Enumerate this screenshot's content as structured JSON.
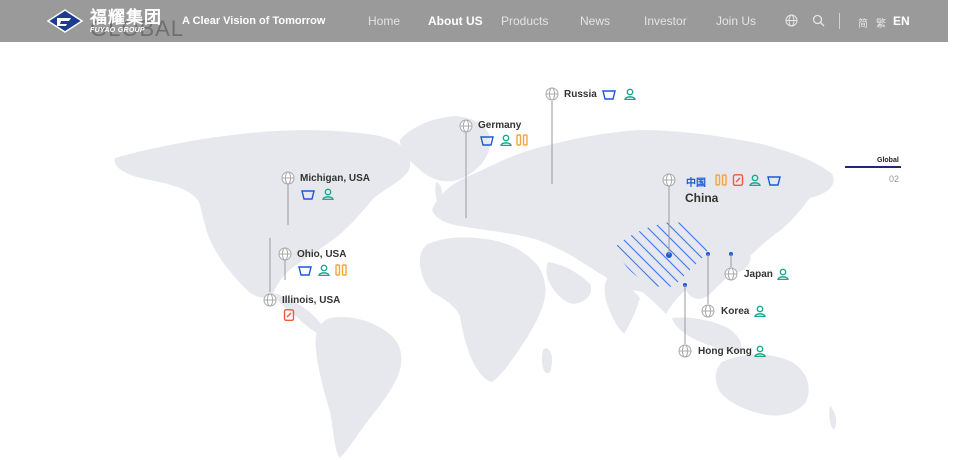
{
  "header": {
    "logo_cn": "福耀集团",
    "logo_en": "FUYAO GROUP",
    "ghost_text": "GLOBAL",
    "slogan": "A Clear Vision of Tomorrow",
    "nav": [
      "Home",
      "About US",
      "Products",
      "News",
      "Investor",
      "Join Us"
    ],
    "active_nav": "About US",
    "lang": {
      "simplified": "简",
      "traditional": "繁",
      "english": "EN"
    }
  },
  "side": {
    "label": "Global",
    "number": "02"
  },
  "locations": {
    "russia": "Russia",
    "germany": "Germany",
    "michigan": "Michigan, USA",
    "ohio": "Ohio, USA",
    "illinois": "Illinois, USA",
    "china_cn": "中国",
    "china": "China",
    "japan": "Japan",
    "korea": "Korea",
    "hongkong": "Hong Kong"
  },
  "colors": {
    "header_bg": "#9a9a9a",
    "map_fill": "#e7e8ed",
    "glass_blue": "#1d57d8",
    "person_teal": "#19a88c",
    "orange": "#f2a53a",
    "red": "#ee5a3b",
    "indicator": "#1c2a78"
  },
  "icons": {
    "glass": "auto-glass-icon",
    "person": "person-icon",
    "bars": "float-glass-icon",
    "tag": "product-tag-icon",
    "globe": "globe-icon"
  }
}
